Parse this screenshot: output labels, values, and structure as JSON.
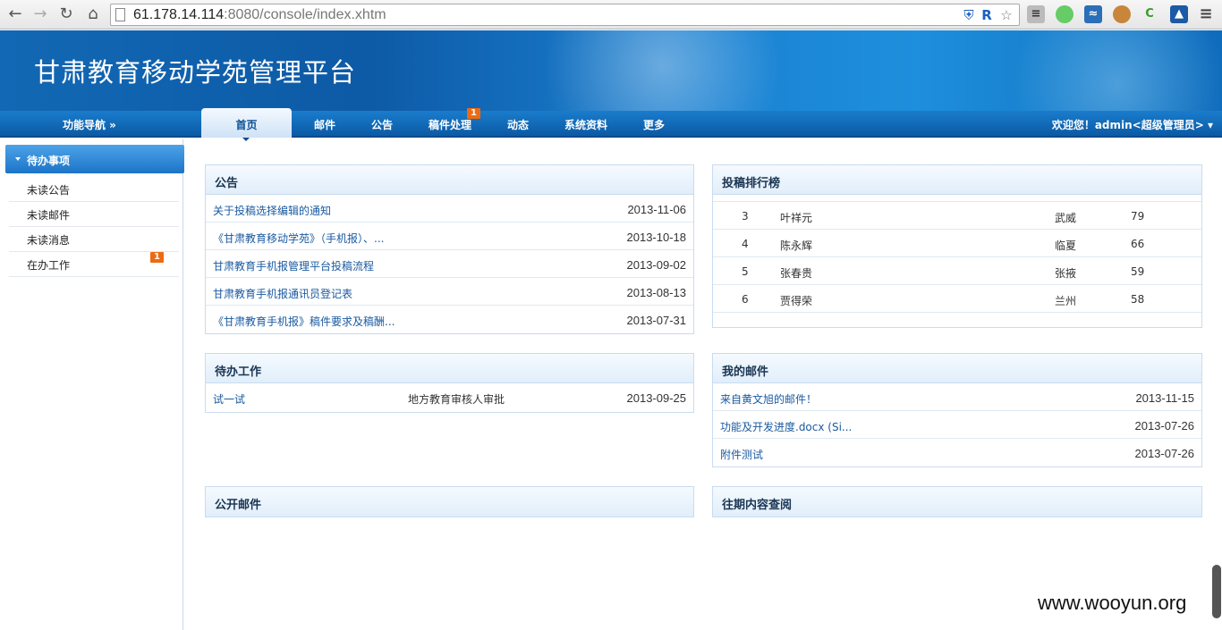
{
  "browser": {
    "url_host": "61.178.14.114",
    "url_rest": ":8080/console/index.xhtm"
  },
  "header": {
    "title": "甘肃教育移动学苑管理平台"
  },
  "nav": {
    "guide": "功能导航 »",
    "tabs": [
      "首页",
      "邮件",
      "公告",
      "稿件处理",
      "动态",
      "系统资料",
      "更多"
    ],
    "manuscript_badge": "1",
    "welcome": "欢迎您！admin<超级管理员>"
  },
  "sidebar": {
    "heading": "待办事项",
    "items": [
      "未读公告",
      "未读邮件",
      "未读消息",
      "在办工作"
    ],
    "work_badge": "1"
  },
  "announcements": {
    "title": "公告",
    "rows": [
      {
        "text": "关于投稿选择编辑的通知",
        "date": "2013-11-06"
      },
      {
        "text": "《甘肃教育移动学苑》（手机报）、...",
        "date": "2013-10-18"
      },
      {
        "text": "甘肃教育手机报管理平台投稿流程",
        "date": "2013-09-02"
      },
      {
        "text": "甘肃教育手机报通讯员登记表",
        "date": "2013-08-13"
      },
      {
        "text": "《甘肃教育手机报》稿件要求及稿酬...",
        "date": "2013-07-31"
      }
    ]
  },
  "ranking": {
    "title": "投稿排行榜",
    "rows": [
      {
        "rank": "3",
        "name": "叶祥元",
        "city": "武威",
        "count": "79"
      },
      {
        "rank": "4",
        "name": "陈永辉",
        "city": "临夏",
        "count": "66"
      },
      {
        "rank": "5",
        "name": "张春贵",
        "city": "张掖",
        "count": "59"
      },
      {
        "rank": "6",
        "name": "贾得荣",
        "city": "兰州",
        "count": "58"
      }
    ]
  },
  "pending": {
    "title": "待办工作",
    "rows": [
      {
        "text": "试一试",
        "stage": "地方教育审核人审批",
        "date": "2013-09-25"
      }
    ]
  },
  "mail": {
    "title": "我的邮件",
    "rows": [
      {
        "text": "来自黄文旭的邮件！",
        "date": "2013-11-15"
      },
      {
        "text": "功能及开发进度.docx (Si...",
        "date": "2013-07-26"
      },
      {
        "text": "附件测试",
        "date": "2013-07-26"
      }
    ]
  },
  "public_mail": {
    "title": "公开邮件"
  },
  "archive": {
    "title": "往期内容查阅"
  },
  "watermark": "www.wooyun.org"
}
